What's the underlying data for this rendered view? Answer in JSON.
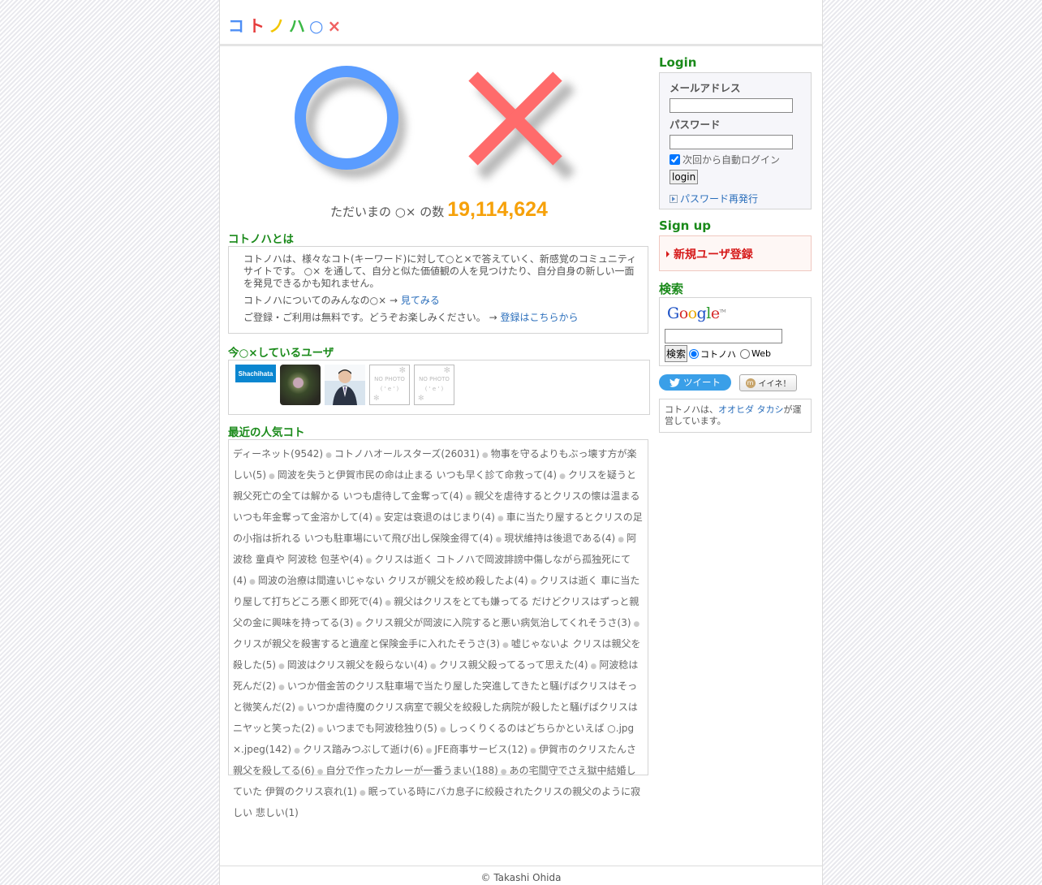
{
  "header": {
    "logo_chars": [
      "コ",
      "ト",
      "ノ",
      "ハ",
      "○",
      "×"
    ],
    "logo_colors": [
      "#4d8ef5",
      "#e63b3b",
      "#f2c500",
      "#3cb846",
      "#4d8ef5",
      "#f06060"
    ]
  },
  "hero": {
    "circle_color": "#5a9cff",
    "cross_color": "#ff6b6b",
    "count_label": "ただいまの ○× の数",
    "count_value": "19,114,624"
  },
  "about": {
    "title": "コトノハとは",
    "description": "コトノハは、様々なコト(キーワード)に対して○と×で答えていく、新感覚のコミュニティサイトです。 ○× を通して、自分と似た価値観の人を見つけたり、自分自身の新しい一面を発見できるかも知れません。",
    "everyone_text": "コトノハについてのみんなの○× →",
    "everyone_link": "見てみる",
    "free_text": "ご登録・ご利用は無料です。どうぞお楽しみください。 →",
    "free_link": "登録はこちらから"
  },
  "users": {
    "title": "今○×しているユーザ",
    "items": [
      {
        "type": "logo",
        "label": "Shachihata"
      },
      {
        "type": "photo-plant"
      },
      {
        "type": "photo-person"
      },
      {
        "type": "nophoto",
        "label": "NO PHOTO",
        "face": "( ' e ' )"
      },
      {
        "type": "nophoto",
        "label": "NO PHOTO",
        "face": "( ' e ' )"
      }
    ]
  },
  "popular": {
    "title": "最近の人気コト",
    "items": [
      "ディーネット(9542)",
      "コトノハオールスターズ(26031)",
      "物事を守るよりもぶっ壊す方が楽しい(5)",
      "岡波を失うと伊賀市民の命は止まる いつも早く診て命救って(4)",
      "クリスを疑うと親父死亡の全ては解かる いつも虐待して金奪って(4)",
      "親父を虐待するとクリスの懐は温まる いつも年金奪って金溶かして(4)",
      "安定は衰退のはじまり(4)",
      "車に当たり屋するとクリスの足の小指は折れる いつも駐車場にいて飛び出し保険金得て(4)",
      "現状維持は後退である(4)",
      "阿波稔 童貞や 阿波稔 包茎や(4)",
      "クリスは逝く コトノハで岡波誹謗中傷しながら孤独死にて(4)",
      "岡波の治療は間違いじゃない クリスが親父を絞め殺したよ(4)",
      "クリスは逝く 車に当たり屋して打ちどころ悪く即死で(4)",
      "親父はクリスをとても嫌ってる だけどクリスはずっと親父の金に興味を持ってる(3)",
      "クリス親父が岡波に入院すると悪い病気治してくれそうさ(3)",
      "クリスが親父を殺害すると遺産と保険金手に入れたそうさ(3)",
      "嘘じゃないよ クリスは親父を殺した(5)",
      "岡波はクリス親父を殺らない(4)",
      "クリス親父殺ってるって思えた(4)",
      "阿波稔は死んだ(2)",
      "いつか借金苦のクリス駐車場で当たり屋した突進してきたと騒げばクリスはそっと微笑んだ(2)",
      "いつか虐待魔のクリス病室で親父を絞殺した病院が殺したと騒げばクリスはニヤッと笑った(2)",
      "いつまでも阿波稔独り(5)",
      "しっくりくるのはどちらかといえば ○.jpg ×.jpeg(142)",
      "クリス踏みつぶして逝け(6)",
      "JFE商事サービス(12)",
      "伊賀市のクリスたんさ 親父を殺してる(6)",
      "自分で作ったカレーが一番うまい(188)",
      "あの宅間守でさえ獄中結婚していた 伊賀のクリス哀れ(1)",
      "眠っている時にバカ息子に絞殺されたクリスの親父のように寂しい 悲しい(1)"
    ]
  },
  "sidebar": {
    "login": {
      "title": "Login",
      "email_label": "メールアドレス",
      "password_label": "パスワード",
      "autologin_label": "次回から自動ログイン",
      "autologin_checked": true,
      "login_button": "login",
      "reissue_link": "パスワード再発行"
    },
    "signup": {
      "title": "Sign up",
      "link": "新規ユーザ登録"
    },
    "search": {
      "title": "検索",
      "google_letters": [
        "G",
        "o",
        "o",
        "g",
        "l",
        "e"
      ],
      "google_colors": [
        "#1a4fc4",
        "#d62b2b",
        "#e8a800",
        "#1a4fc4",
        "#2b9a2b",
        "#d62b2b"
      ],
      "tm": "TM",
      "button": "検索",
      "radio_site": "コトノハ",
      "radio_web": "Web",
      "selected": "site"
    },
    "tweet_label": "ツイート",
    "mixi_label": "イイネ！",
    "operator_prefix": "コトノハは、",
    "operator_name": "オオヒダ タカシ",
    "operator_suffix": "が運営しています。"
  },
  "footer": {
    "copyright": "©  Takashi Ohida"
  }
}
